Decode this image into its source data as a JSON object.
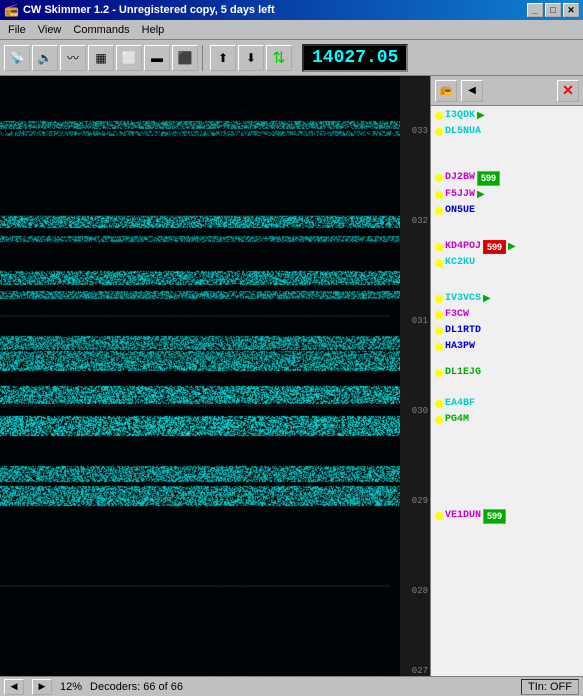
{
  "titleBar": {
    "title": "CW Skimmer 1.2 - Unregistered copy, 5 days left",
    "minButton": "_",
    "maxButton": "□",
    "closeButton": "✕"
  },
  "menuBar": {
    "items": [
      "File",
      "View",
      "Commands",
      "Help"
    ]
  },
  "toolbar": {
    "frequency": "14027.05"
  },
  "freqScale": {
    "labels": [
      "033",
      "032",
      "031",
      "030",
      "029",
      "028",
      "027"
    ]
  },
  "callsigns": [
    {
      "dot": "yellow",
      "name": "I3QDK",
      "color": "cyan",
      "arrow": true
    },
    {
      "dot": "yellow",
      "name": "DL5NUA",
      "color": "cyan",
      "arrow": false
    },
    {
      "dot": "yellow",
      "name": "",
      "color": "",
      "arrow": false
    },
    {
      "dot": "yellow",
      "name": "DJ2BW",
      "color": "magenta",
      "badge": null,
      "arrow": false
    },
    {
      "dot": "green",
      "name": "599",
      "color": "magenta",
      "badge": "599",
      "arrow": false,
      "isBadge": true,
      "badgeType": "green"
    },
    {
      "dot": "yellow",
      "name": "F5JJW",
      "color": "magenta",
      "arrow": true
    },
    {
      "dot": "yellow",
      "name": "ON5UE",
      "color": "blue",
      "arrow": false
    },
    {
      "dot": "yellow",
      "name": "",
      "color": "",
      "arrow": false
    },
    {
      "dot": "yellow",
      "name": "KD4POJ",
      "color": "magenta",
      "badge": "599",
      "badgeType": "red",
      "arrow": true
    },
    {
      "dot": "yellow",
      "name": "KC2KU",
      "color": "cyan",
      "arrow": false
    },
    {
      "dot": "yellow",
      "name": "",
      "color": "",
      "arrow": false
    },
    {
      "dot": "yellow",
      "name": "IV3VCS",
      "color": "cyan",
      "arrow": true
    },
    {
      "dot": "yellow",
      "name": "F3CW",
      "color": "magenta",
      "arrow": false
    },
    {
      "dot": "yellow",
      "name": "DL1RTD",
      "color": "blue",
      "arrow": false
    },
    {
      "dot": "yellow",
      "name": "HA3PW",
      "color": "blue",
      "arrow": false
    },
    {
      "dot": "yellow",
      "name": "",
      "color": "",
      "arrow": false
    },
    {
      "dot": "yellow",
      "name": "DL1EJG",
      "color": "green",
      "arrow": false
    },
    {
      "dot": "yellow",
      "name": "",
      "color": "",
      "arrow": false
    },
    {
      "dot": "yellow",
      "name": "EA4BF",
      "color": "cyan",
      "arrow": false
    },
    {
      "dot": "yellow",
      "name": "PG4M",
      "color": "green",
      "arrow": false
    },
    {
      "dot": "yellow",
      "name": "",
      "color": "",
      "arrow": false
    },
    {
      "dot": "yellow",
      "name": "",
      "color": "",
      "arrow": false
    },
    {
      "dot": "yellow",
      "name": "",
      "color": "",
      "arrow": false
    },
    {
      "dot": "yellow",
      "name": "VE1DUN",
      "color": "magenta",
      "badge": "599",
      "badgeType": "green",
      "arrow": false
    }
  ],
  "statusBar": {
    "zoom": "12%",
    "decoders": "Decoders: 66 of 66",
    "tln": "TIn: OFF"
  }
}
